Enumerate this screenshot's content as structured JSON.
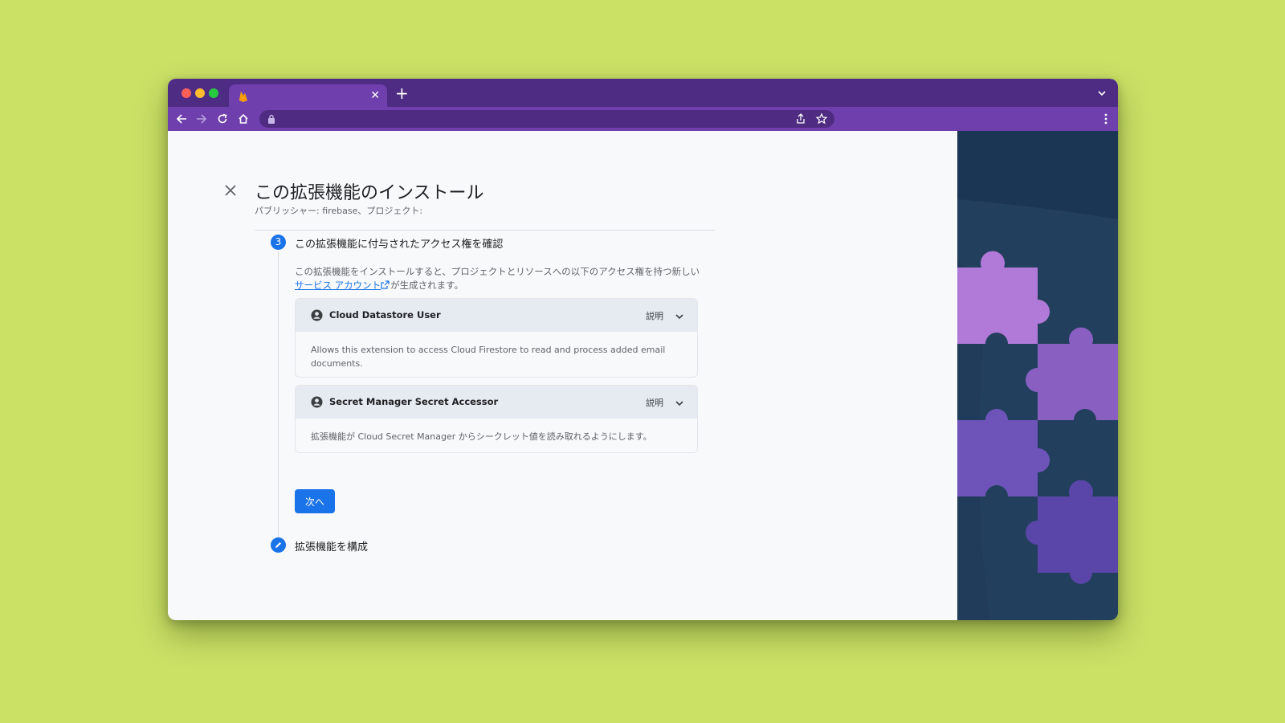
{
  "page": {
    "title": "この拡張機能のインストール",
    "subtitle": "パブリッシャー: firebase、プロジェクト:"
  },
  "step3": {
    "number": "3",
    "title": "この拡張機能に付与されたアクセス権を確認",
    "description_line1": "この拡張機能をインストールすると、プロジェクトとリソースへの以下のアクセス権を持つ新しい",
    "service_account_link": "サービス アカウント",
    "description_line2_suffix": "が生成されます。"
  },
  "roles": [
    {
      "name": "Cloud Datastore User",
      "explain_label": "説明",
      "description": "Allows this extension to access Cloud Firestore to read and process added email documents."
    },
    {
      "name": "Secret Manager Secret Accessor",
      "explain_label": "説明",
      "description": "拡張機能が Cloud Secret Manager からシークレット値を読み取れるようにします。"
    }
  ],
  "next_button": "次へ",
  "step_configure": {
    "title": "拡張機能を構成"
  },
  "colors": {
    "background": "#cbe166",
    "browser_frame": "#6f3fae",
    "accent": "#1a73e8",
    "highlight_arrow": "#22e0ff"
  }
}
